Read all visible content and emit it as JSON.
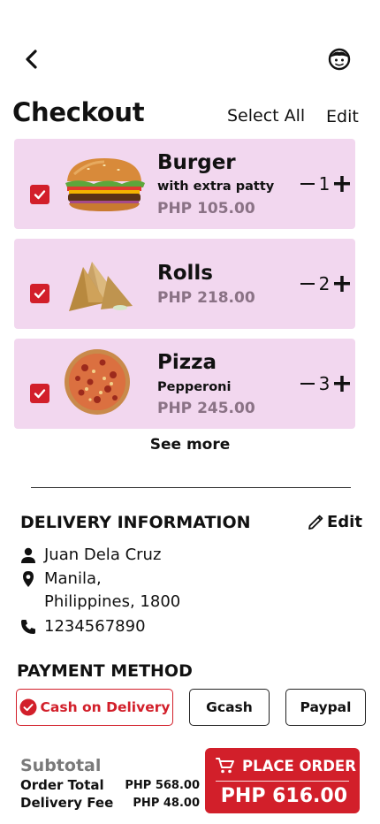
{
  "header": {
    "title": "Checkout",
    "select_all": "Select All",
    "edit": "Edit"
  },
  "cart": {
    "items": [
      {
        "name": "Burger",
        "description": "with extra patty",
        "price": "PHP 105.00",
        "quantity": "1",
        "checked": true
      },
      {
        "name": "Rolls",
        "description": "",
        "price": "PHP 218.00",
        "quantity": "2",
        "checked": true
      },
      {
        "name": "Pizza",
        "description": "Pepperoni",
        "price": "PHP 245.00",
        "quantity": "3",
        "checked": true
      }
    ],
    "see_more": "See more"
  },
  "delivery": {
    "title": "DELIVERY INFORMATION",
    "edit": "Edit",
    "name": "Juan Dela Cruz",
    "address_line1": "Manila,",
    "address_line2": "Philippines, 1800",
    "phone": "1234567890"
  },
  "payment": {
    "title": "PAYMENT METHOD",
    "options": [
      "Cash on Delivery",
      "Gcash",
      "Paypal"
    ],
    "selected": "Cash on Delivery"
  },
  "summary": {
    "subtotal_label": "Subtotal",
    "order_total_label": "Order Total",
    "order_total_value": "PHP 568.00",
    "delivery_fee_label": "Delivery Fee",
    "delivery_fee_value": "PHP 48.00"
  },
  "place_order": {
    "label": "PLACE ORDER",
    "total": "PHP 616.00"
  },
  "colors": {
    "accent": "#d21f2a",
    "card_bg": "#f2d7ef",
    "price_text": "#8a7285"
  },
  "icons": [
    "back-arrow-icon",
    "profile-icon",
    "checkbox-icon",
    "minus-icon",
    "plus-icon",
    "pencil-icon",
    "person-icon",
    "location-pin-icon",
    "phone-icon",
    "check-circle-icon",
    "cart-icon"
  ]
}
